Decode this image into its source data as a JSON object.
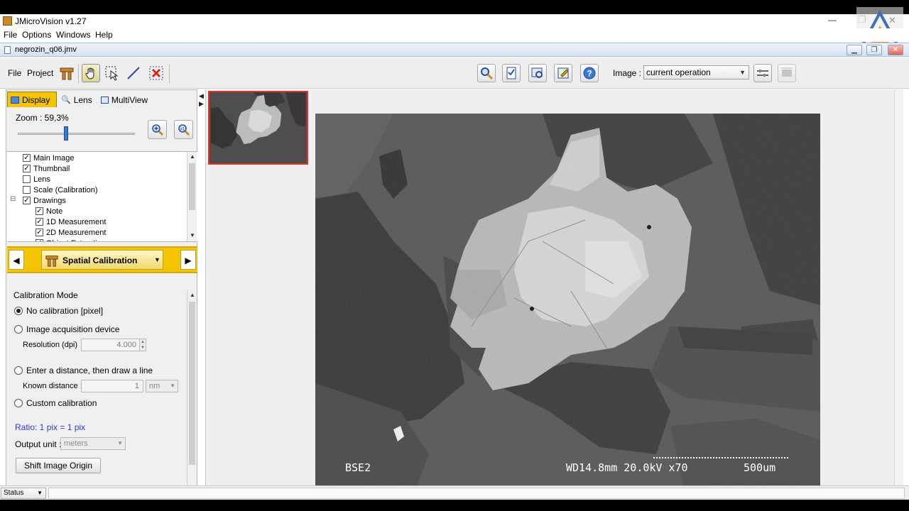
{
  "window": {
    "title": "JMicroVision v1.27",
    "minimize": "—",
    "restore": "❐",
    "close": "✕"
  },
  "menu": [
    "File",
    "Options",
    "Windows",
    "Help"
  ],
  "document": {
    "title": "negrozin_q06.jmv"
  },
  "toolbar": {
    "file": "File",
    "project": "Project",
    "image_label": "Image :",
    "image_select": "current operation"
  },
  "tabs": {
    "display": "Display",
    "lens": "Lens",
    "multiview": "MultiView"
  },
  "zoom": {
    "label": "Zoom : 59,3%",
    "level_percent": 59.3
  },
  "layers": [
    {
      "label": "Main Image",
      "checked": true,
      "indent": 1
    },
    {
      "label": "Thumbnail",
      "checked": true,
      "indent": 1
    },
    {
      "label": "Lens",
      "checked": false,
      "indent": 1
    },
    {
      "label": "Scale (Calibration)",
      "checked": false,
      "indent": 1
    },
    {
      "label": "Drawings",
      "checked": true,
      "indent": 1,
      "expander": "⊟"
    },
    {
      "label": "Note",
      "checked": true,
      "indent": 2
    },
    {
      "label": "1D Measurement",
      "checked": true,
      "indent": 2
    },
    {
      "label": "2D Measurement",
      "checked": true,
      "indent": 2
    },
    {
      "label": "Object Extraction",
      "checked": true,
      "indent": 2
    }
  ],
  "module": {
    "title": "Spatial Calibration"
  },
  "calibration": {
    "section": "Calibration Mode",
    "no_calibration": "No calibration [pixel]",
    "acquisition": "Image acquisition device",
    "resolution_label": "Resolution (dpi)",
    "resolution_value": "4.000",
    "distance": "Enter a distance, then draw a line",
    "known_label": "Known distance :",
    "known_value": "1",
    "known_unit": "nm",
    "custom": "Custom calibration",
    "ratio": "Ratio: 1 pix = 1 pix",
    "output_label": "Output unit :",
    "output_value": "meters",
    "shift_button": "Shift Image Origin"
  },
  "image_overlay": {
    "left": "BSE2",
    "right": "WD14.8mm 20.0kV x70",
    "scale": "500um"
  },
  "status": {
    "label": "Status"
  },
  "colors": {
    "accent": "#f4c400",
    "ratio_text": "#2a3fd0"
  }
}
